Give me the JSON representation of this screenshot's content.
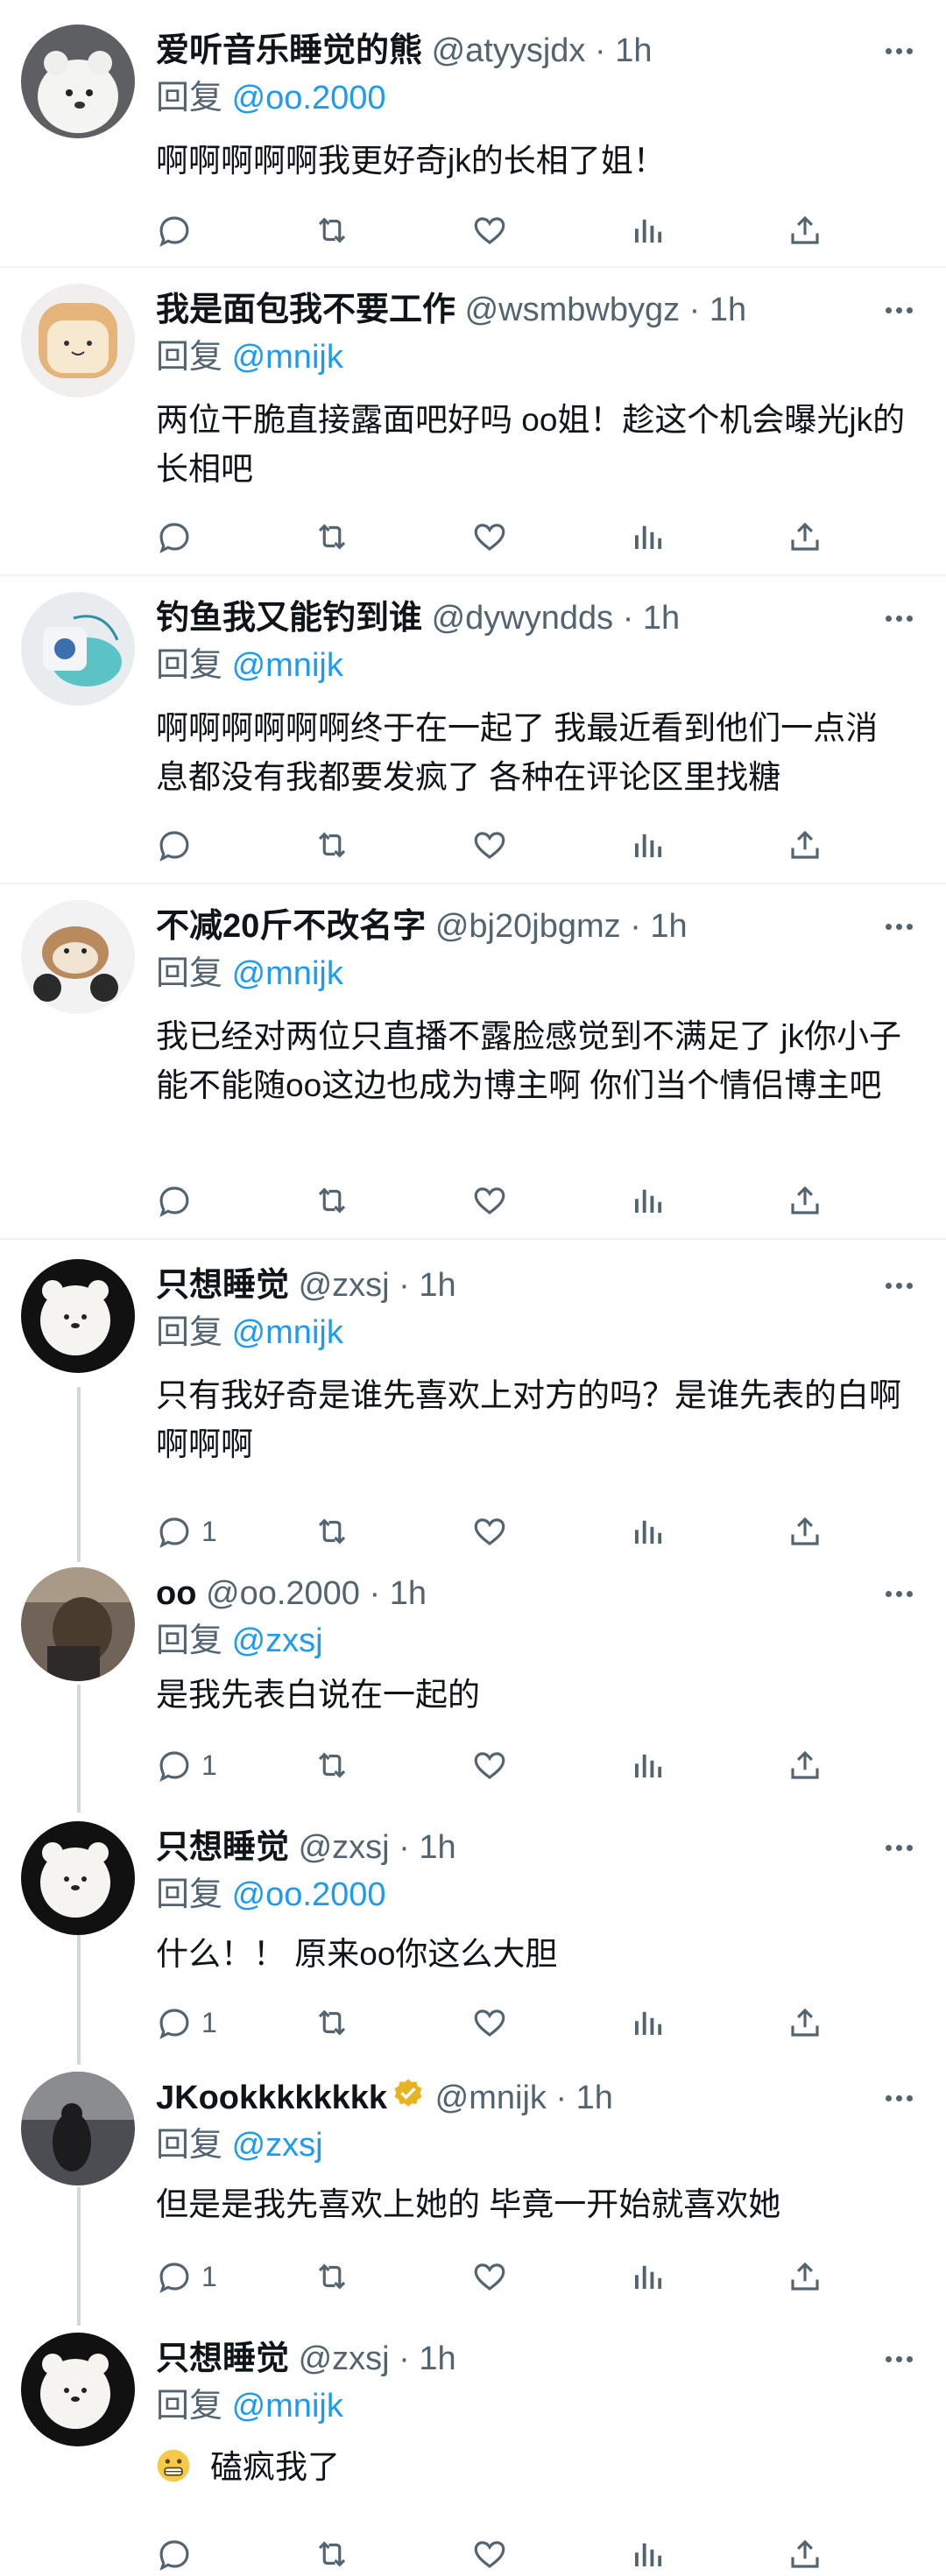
{
  "reply_prefix": "回复",
  "colors": {
    "text": "#0f1419",
    "secondary": "#536471",
    "link": "#1d9bf0",
    "divider": "#eff3f4"
  },
  "tweets": [
    {
      "name": "爱听音乐睡觉的熊",
      "handle": "@atyysjdx",
      "time": "1h",
      "reply_to": "@oo.2000",
      "text": "啊啊啊啊啊我更好奇jk的长相了姐！",
      "replies": ""
    },
    {
      "name": "我是面包我不要工作",
      "handle": "@wsmbwbygz",
      "time": "1h",
      "reply_to": "@mnijk",
      "text": "两位干脆直接露面吧好吗 oo姐！趁这个机会曝光jk的长相吧",
      "replies": ""
    },
    {
      "name": "钓鱼我又能钓到谁",
      "handle": "@dywyndds",
      "time": "1h",
      "reply_to": "@mnijk",
      "text": "啊啊啊啊啊啊终于在一起了 我最近看到他们一点消息都没有我都要发疯了 各种在评论区里找糖",
      "replies": ""
    },
    {
      "name": "不减20斤不改名字",
      "handle": "@bj20jbgmz",
      "time": "1h",
      "reply_to": "@mnijk",
      "text": "我已经对两位只直播不露脸感觉到不满足了 jk你小子能不能随oo这边也成为博主啊 你们当个情侣博主吧",
      "replies": ""
    },
    {
      "name": "只想睡觉",
      "handle": "@zxsj",
      "time": "1h",
      "reply_to": "@mnijk",
      "text": "只有我好奇是谁先喜欢上对方的吗？是谁先表的白啊啊啊啊",
      "replies": "1"
    },
    {
      "name": "oo",
      "handle": "@oo.2000",
      "time": "1h",
      "reply_to": "@zxsj",
      "text": "是我先表白说在一起的",
      "replies": "1"
    },
    {
      "name": "只想睡觉",
      "handle": "@zxsj",
      "time": "1h",
      "reply_to": "@oo.2000",
      "text": "什么！！ 原来oo你这么大胆",
      "replies": "1"
    },
    {
      "name": "JKookkkkkkkk",
      "handle": "@mnijk",
      "time": "1h",
      "reply_to": "@zxsj",
      "text": "但是是我先喜欢上她的 毕竟一开始就喜欢她",
      "replies": "1",
      "verified": true
    },
    {
      "name": "只想睡觉",
      "handle": "@zxsj",
      "time": "1h",
      "reply_to": "@mnijk",
      "text": "磕疯我了",
      "replies": "",
      "emoji": "grimacing-face"
    }
  ],
  "icons": {
    "reply": "reply-icon",
    "retweet": "retweet-icon",
    "like": "like-icon",
    "views": "views-icon",
    "share": "share-icon",
    "more": "more-icon",
    "verified": "verified-badge-icon"
  }
}
